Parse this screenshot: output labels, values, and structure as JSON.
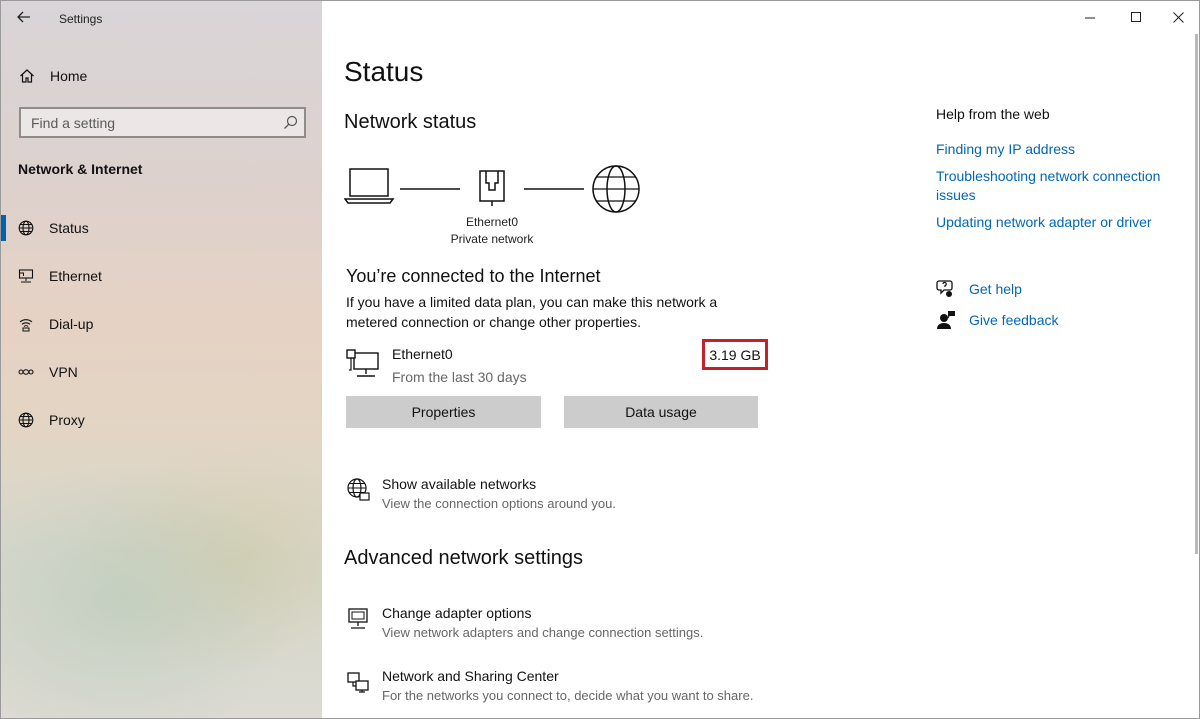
{
  "window": {
    "title": "Settings",
    "controls": {
      "minimize": "—",
      "maximize": "☐",
      "close": "✕"
    }
  },
  "sidebar": {
    "home_label": "Home",
    "search_placeholder": "Find a setting",
    "section_title": "Network & Internet",
    "items": [
      {
        "label": "Status",
        "icon": "globe-icon",
        "active": true
      },
      {
        "label": "Ethernet",
        "icon": "ethernet-icon",
        "active": false
      },
      {
        "label": "Dial-up",
        "icon": "dialup-icon",
        "active": false
      },
      {
        "label": "VPN",
        "icon": "vpn-icon",
        "active": false
      },
      {
        "label": "Proxy",
        "icon": "globe-icon",
        "active": false
      }
    ]
  },
  "main": {
    "page_title": "Status",
    "network_status_heading": "Network status",
    "diagram": {
      "adapter_name": "Ethernet0",
      "network_type": "Private network"
    },
    "connection": {
      "title": "You’re connected to the Internet",
      "description": "If you have a limited data plan, you can make this network a metered connection or change other properties.",
      "network_name": "Ethernet0",
      "period": "From the last 30 days",
      "usage": "3.19 GB"
    },
    "buttons": {
      "properties": "Properties",
      "data_usage": "Data usage"
    },
    "show_networks": {
      "title": "Show available networks",
      "subtitle": "View the connection options around you."
    },
    "advanced_heading": "Advanced network settings",
    "advanced_items": [
      {
        "title": "Change adapter options",
        "subtitle": "View network adapters and change connection settings."
      },
      {
        "title": "Network and Sharing Center",
        "subtitle": "For the networks you connect to, decide what you want to share."
      }
    ]
  },
  "help": {
    "heading": "Help from the web",
    "links": [
      "Finding my IP address",
      "Troubleshooting network connection issues",
      "Updating network adapter or driver"
    ],
    "get_help": "Get help",
    "give_feedback": "Give feedback"
  },
  "colors": {
    "accent": "#0063b1",
    "link": "#0067b8",
    "highlight_box": "#c5202e",
    "button_bg": "#cccccc"
  }
}
